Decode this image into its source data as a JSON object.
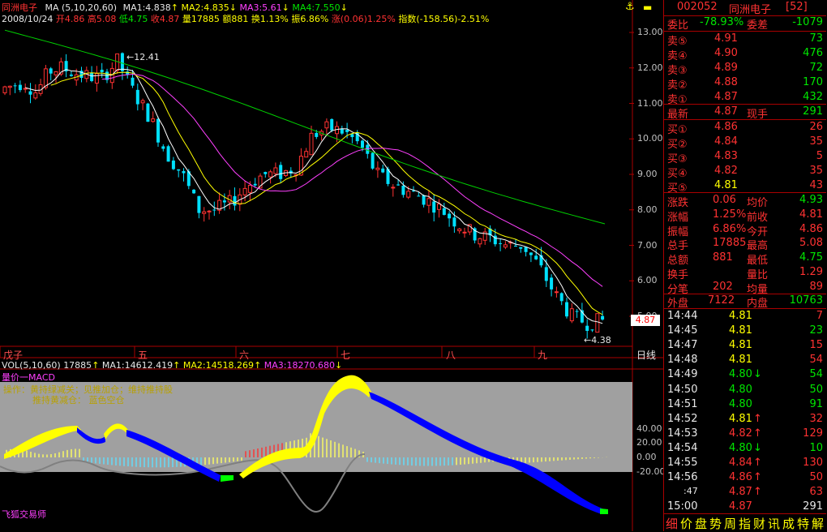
{
  "header": {
    "title": "同洲电子",
    "ma_label": "MA (5,10,20,60)",
    "ma1": "MA1:4.838",
    "ma2": "MA2:4.835",
    "ma3": "MA3:5.61",
    "ma4": "MA4:7.550",
    "info_date": "2008/10/24",
    "info_open": "开4.86",
    "info_high": "高5.08",
    "info_low": "低4.75",
    "info_close": "收4.87",
    "info_vol": "量17885",
    "info_amt": "额881",
    "info_turn": "换1.13%",
    "info_amp": "振6.86%",
    "info_chg": "涨(0.06)1.25%",
    "info_index": "指数(-158.56)-2.51%"
  },
  "price_axis": [
    "13.00",
    "12.00",
    "11.00",
    "10.00",
    "9.00",
    "8.00",
    "7.00",
    "6.00",
    "5.00"
  ],
  "price_tag": "4.87",
  "high_label": "12.41",
  "low_label": "4.38",
  "months": [
    "戊子",
    "五",
    "六",
    "七",
    "八",
    "九"
  ],
  "period": "日线",
  "vol": {
    "label": "VOL(5,10,60)",
    "value": "17885",
    "ma1": "MA1:14612.419",
    "ma2": "MA2:14518.269",
    "ma3": "MA3:18270.680"
  },
  "macd": {
    "title": "量价一MACD",
    "legend1": "操作：黄持绿减关；见推加仓；维持推持股",
    "legend2": "推持黄减仓：  蓝色空仓",
    "axis": [
      "40.00",
      "20.00",
      "0.00",
      "-20.00"
    ],
    "author": "飞狐交易师"
  },
  "panel": {
    "code": "002052",
    "name": "同洲电子",
    "tag": "[52]",
    "weibi_label": "委比",
    "weibi_value": "-78.93%",
    "weicha_label": "委差",
    "weicha_value": "-1079",
    "sells": [
      {
        "label": "卖⑤",
        "price": "4.91",
        "vol": "73"
      },
      {
        "label": "卖④",
        "price": "4.90",
        "vol": "476"
      },
      {
        "label": "卖③",
        "price": "4.89",
        "vol": "72"
      },
      {
        "label": "卖②",
        "price": "4.88",
        "vol": "170"
      },
      {
        "label": "卖①",
        "price": "4.87",
        "vol": "432"
      }
    ],
    "latest_label": "最新",
    "latest_price": "4.87",
    "xianshou_label": "现手",
    "xianshou_value": "291",
    "buys": [
      {
        "label": "买①",
        "price": "4.86",
        "vol": "26"
      },
      {
        "label": "买②",
        "price": "4.84",
        "vol": "35"
      },
      {
        "label": "买③",
        "price": "4.83",
        "vol": "5"
      },
      {
        "label": "买④",
        "price": "4.82",
        "vol": "35"
      },
      {
        "label": "买⑤",
        "price": "4.81",
        "vol": "43"
      }
    ],
    "stats": [
      {
        "l1": "涨跌",
        "v1": "0.06",
        "l2": "均价",
        "v2": "4.93"
      },
      {
        "l1": "涨幅",
        "v1": "1.25%",
        "l2": "前收",
        "v2": "4.81"
      },
      {
        "l1": "振幅",
        "v1": "6.86%",
        "l2": "今开",
        "v2": "4.86"
      },
      {
        "l1": "总手",
        "v1": "17885",
        "l2": "最高",
        "v2": "5.08"
      },
      {
        "l1": "总额",
        "v1": "881",
        "l2": "最低",
        "v2": "4.75"
      },
      {
        "l1": "换手",
        "v1": "",
        "l2": "量比",
        "v2": "1.29"
      },
      {
        "l1": "分笔",
        "v1": "202",
        "l2": "均量",
        "v2": "89"
      }
    ],
    "waipan_label": "外盘",
    "waipan_value": "7122",
    "neipan_label": "内盘",
    "neipan_value": "10763",
    "ticks": [
      {
        "time": "14:44",
        "price": "4.81",
        "dir": "",
        "vol": "7",
        "pc": "yel",
        "vc": "red"
      },
      {
        "time": "14:45",
        "price": "4.81",
        "dir": "",
        "vol": "23",
        "pc": "yel",
        "vc": "grn"
      },
      {
        "time": "14:47",
        "price": "4.81",
        "dir": "",
        "vol": "15",
        "pc": "yel",
        "vc": "red"
      },
      {
        "time": "14:48",
        "price": "4.81",
        "dir": "",
        "vol": "54",
        "pc": "yel",
        "vc": "red"
      },
      {
        "time": "14:49",
        "price": "4.80",
        "dir": "↓",
        "vol": "54",
        "pc": "grn",
        "vc": "grn"
      },
      {
        "time": "14:50",
        "price": "4.80",
        "dir": "",
        "vol": "50",
        "pc": "grn",
        "vc": "grn"
      },
      {
        "time": "14:51",
        "price": "4.80",
        "dir": "",
        "vol": "91",
        "pc": "grn",
        "vc": "grn"
      },
      {
        "time": "14:52",
        "price": "4.81",
        "dir": "↑",
        "vol": "32",
        "pc": "yel",
        "vc": "red"
      },
      {
        "time": "14:53",
        "price": "4.82",
        "dir": "↑",
        "vol": "129",
        "pc": "red",
        "vc": "red"
      },
      {
        "time": "14:54",
        "price": "4.80",
        "dir": "↓",
        "vol": "10",
        "pc": "grn",
        "vc": "grn"
      },
      {
        "time": "14:55",
        "price": "4.84",
        "dir": "↑",
        "vol": "130",
        "pc": "red",
        "vc": "red"
      },
      {
        "time": "14:56",
        "price": "4.86",
        "dir": "↑",
        "vol": "50",
        "pc": "red",
        "vc": "red"
      },
      {
        "time": ":47",
        "price": "4.87",
        "dir": "↑",
        "vol": "63",
        "pc": "red",
        "vc": "red"
      },
      {
        "time": "15:00",
        "price": "4.87",
        "dir": "",
        "vol": "291",
        "pc": "red",
        "vc": "wht"
      }
    ],
    "tabs": [
      "细",
      "价",
      "盘",
      "势",
      "周",
      "指",
      "财",
      "讯",
      "成",
      "特",
      "解"
    ]
  },
  "colors": {
    "up": "#ff3232",
    "down": "#00e0ff",
    "ma5": "#ffffff",
    "ma10": "#ffff00",
    "ma20": "#ff40ff",
    "ma60": "#00d000"
  }
}
